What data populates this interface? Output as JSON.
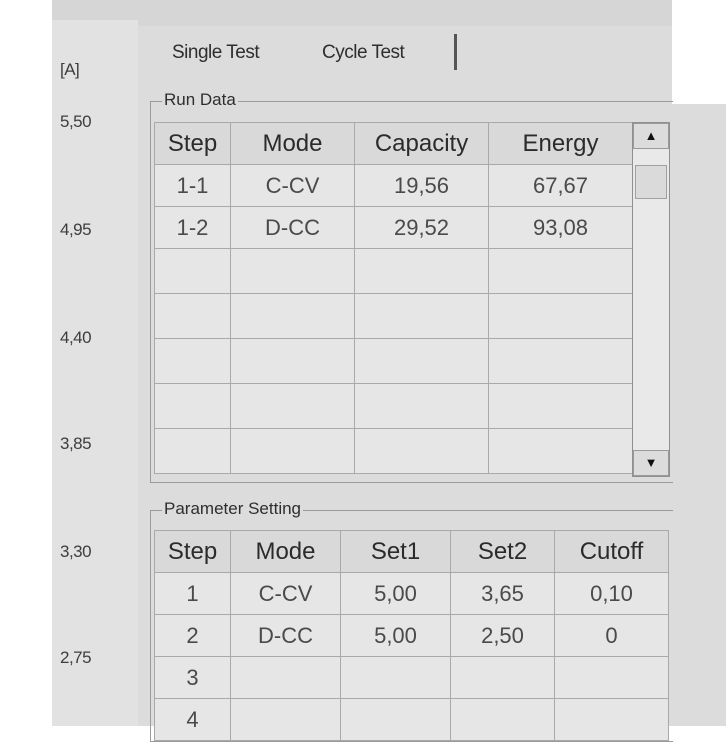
{
  "axis": {
    "unit": "[A]",
    "ticks": [
      "5,50",
      "4,95",
      "4,40",
      "3,85",
      "3,30",
      "2,75"
    ]
  },
  "tabs": [
    {
      "label": "Single Test"
    },
    {
      "label": "Cycle Test"
    }
  ],
  "run_data": {
    "caption": "Run Data",
    "columns": [
      "Step",
      "Mode",
      "Capacity",
      "Energy"
    ],
    "rows": [
      {
        "step": "1-1",
        "mode": "C-CV",
        "capacity": "19,56",
        "energy": "67,67"
      },
      {
        "step": "1-2",
        "mode": "D-CC",
        "capacity": "29,52",
        "energy": "93,08"
      }
    ],
    "scroll_up_icon": "triangle-up",
    "scroll_down_icon": "triangle-down"
  },
  "parameter_setting": {
    "caption": "Parameter Setting",
    "columns": [
      "Step",
      "Mode",
      "Set1",
      "Set2",
      "Cutoff"
    ],
    "rows": [
      {
        "step": "1",
        "mode": "C-CV",
        "set1": "5,00",
        "set2": "3,65",
        "cutoff": "0,10"
      },
      {
        "step": "2",
        "mode": "D-CC",
        "set1": "5,00",
        "set2": "2,50",
        "cutoff": "0"
      },
      {
        "step": "3",
        "mode": "",
        "set1": "",
        "set2": "",
        "cutoff": ""
      },
      {
        "step": "4",
        "mode": "",
        "set1": "",
        "set2": "",
        "cutoff": ""
      }
    ]
  }
}
